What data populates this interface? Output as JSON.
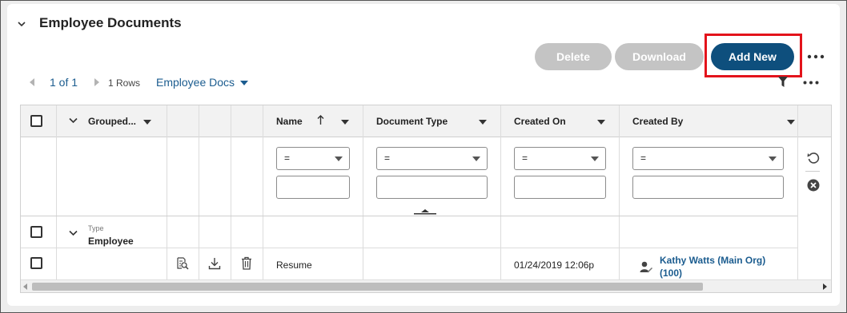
{
  "section": {
    "title": "Employee Documents"
  },
  "toolbar": {
    "delete_label": "Delete",
    "download_label": "Download",
    "add_new_label": "Add New",
    "more_label": "•••"
  },
  "pager": {
    "page_text": "1 of 1",
    "rows_text": "1 Rows",
    "view_label": "Employee Docs"
  },
  "grid": {
    "columns": {
      "grouped": "Grouped...",
      "name": "Name",
      "document_type": "Document Type",
      "created_on": "Created On",
      "created_by": "Created By"
    },
    "filters": {
      "name_op": "=",
      "doc_type_op": "=",
      "created_on_op": "=",
      "created_by_op": "="
    },
    "group": {
      "label": "Type",
      "value": "Employee"
    },
    "rows": [
      {
        "name": "Resume",
        "document_type": "",
        "created_on": "01/24/2019 12:06p",
        "created_by_line1": "Kathy Watts (Main Org)",
        "created_by_line2": "(100)"
      }
    ]
  },
  "colors": {
    "primary": "#0e4f7d",
    "disabled": "#c4c4c4",
    "highlight": "#e3131b",
    "link": "#1b5c8f"
  }
}
